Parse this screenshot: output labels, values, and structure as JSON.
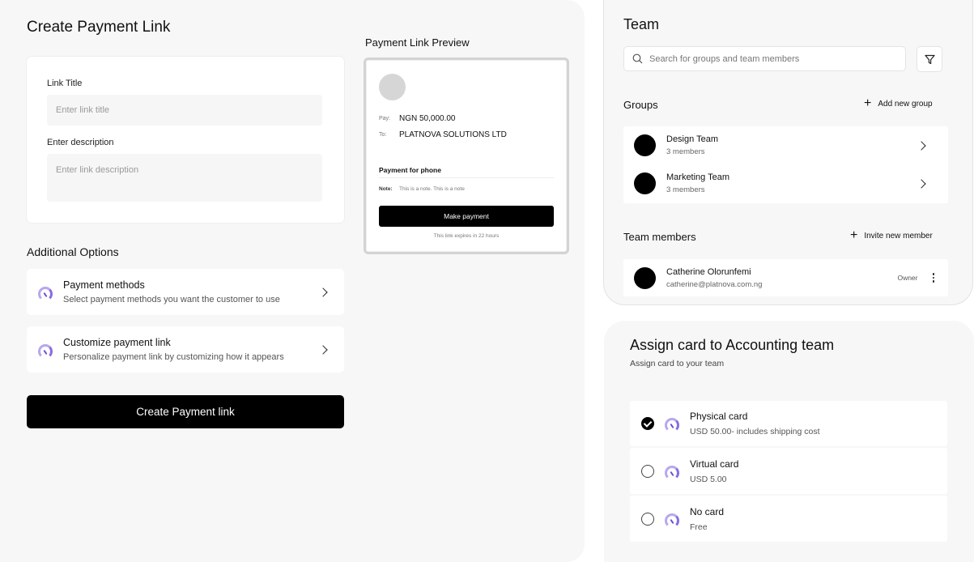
{
  "create": {
    "title": "Create Payment Link",
    "link_title_label": "Link Title",
    "link_title_placeholder": "Enter link title",
    "description_label": "Enter description",
    "description_placeholder": "Enter link description",
    "additional_options": "Additional Options",
    "options": [
      {
        "title": "Payment methods",
        "subtitle": "Select payment methods you want the customer to use",
        "icon": "gauge-icon"
      },
      {
        "title": "Customize payment link",
        "subtitle": "Personalize payment link by customizing how it appears",
        "icon": "gauge-icon"
      }
    ],
    "submit_label": "Create Payment link"
  },
  "preview": {
    "title": "Payment Link Preview",
    "pay_label": "Pay:",
    "pay_value": "NGN 50,000.00",
    "to_label": "To:",
    "to_value": "PLATNOVA SOLUTIONS LTD",
    "heading": "Payment for phone",
    "note_label": "Note:",
    "note_value": "This is a note. This is a note",
    "button_label": "Make payment",
    "expiry": "This link expires in 22 hours"
  },
  "team": {
    "title": "Team",
    "search_placeholder": "Search for groups and team members",
    "groups_title": "Groups",
    "add_group": "Add new group",
    "groups": [
      {
        "name": "Design Team",
        "members": "3 members"
      },
      {
        "name": "Marketing Team",
        "members": "3 members"
      }
    ],
    "members_title": "Team members",
    "invite": "Invite new member",
    "members": [
      {
        "name": "Catherine Olorunfemi",
        "email": "catherine@platnova.com.ng",
        "role": "Owner"
      }
    ]
  },
  "assign": {
    "title": "Assign card to Accounting team",
    "subtitle": "Assign card to your team",
    "cards": [
      {
        "name": "Physical card",
        "detail": "USD 50.00- includes shipping cost",
        "selected": true
      },
      {
        "name": "Virtual card",
        "detail": "USD 5.00",
        "selected": false
      },
      {
        "name": "No card",
        "detail": "Free",
        "selected": false
      }
    ]
  },
  "colors": {
    "accent": "#000000",
    "icon_purple": "#8a6ce0",
    "panel_bg": "#f7f7f7"
  }
}
